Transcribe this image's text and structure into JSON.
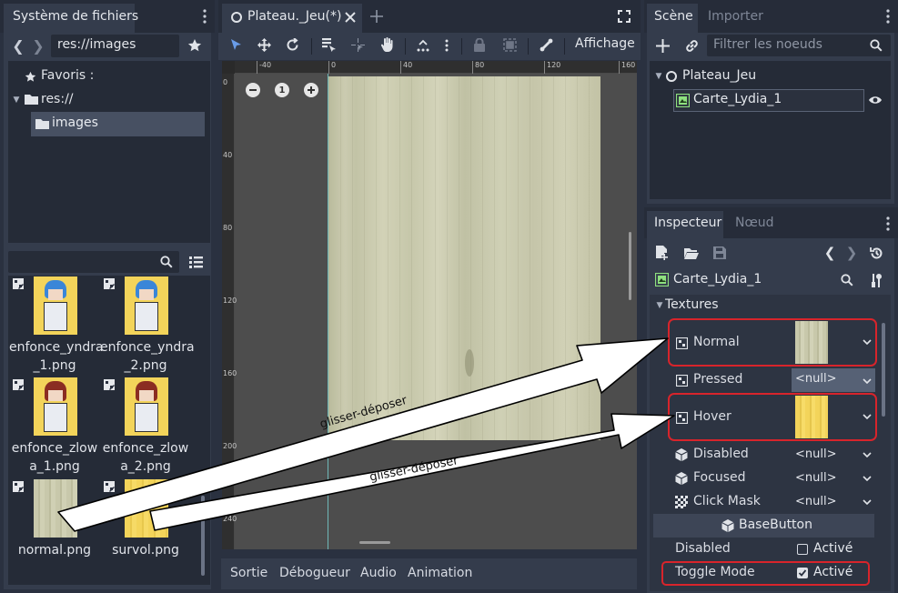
{
  "filesystem": {
    "title": "Système de fichiers",
    "path": "res://images",
    "tree": {
      "favorites": "Favoris :",
      "root": "res://",
      "folder": "images"
    },
    "files": [
      {
        "name_line1": "enfonce_yndra",
        "name_line2": "_1.png"
      },
      {
        "name_line1": "enfonce_yndra",
        "name_line2": "_2.png"
      },
      {
        "name_line1": "enfonce_zlow",
        "name_line2": "a_1.png"
      },
      {
        "name_line1": "enfonce_zlow",
        "name_line2": "a_2.png"
      },
      {
        "name_line1": "normal.png",
        "name_line2": ""
      },
      {
        "name_line1": "survol.png",
        "name_line2": ""
      }
    ]
  },
  "editor": {
    "tab_title": "Plateau._Jeu(*)",
    "view_menu": "Affichage",
    "ruler_top": [
      "-40",
      "0",
      "40",
      "80",
      "120",
      "160"
    ],
    "ruler_left": [
      "0",
      "40",
      "80",
      "120",
      "160",
      "200",
      "240"
    ],
    "zoom_reset": "1",
    "bottom_tabs": [
      "Sortie",
      "Débogueur",
      "Audio",
      "Animation"
    ]
  },
  "annotations": {
    "arrow1": "glisser-déposer",
    "arrow2": "glisser-déposer"
  },
  "scene": {
    "tab_scene": "Scène",
    "tab_import": "Importer",
    "filter_placeholder": "Filtrer les noeuds",
    "root_node": "Plateau_Jeu",
    "child_node": "Carte_Lydia_1"
  },
  "inspector": {
    "tab_inspector": "Inspecteur",
    "tab_node": "Nœud",
    "node_name": "Carte_Lydia_1",
    "section": "Textures",
    "props": [
      {
        "label": "Normal",
        "value": ""
      },
      {
        "label": "Pressed",
        "value": "<null>"
      },
      {
        "label": "Hover",
        "value": ""
      },
      {
        "label": "Disabled",
        "value": "<null>"
      },
      {
        "label": "Focused",
        "value": "<null>"
      },
      {
        "label": "Click Mask",
        "value": "<null>"
      }
    ],
    "category": "BaseButton",
    "bool_props": [
      {
        "label": "Disabled",
        "value": "Activé",
        "checked": false
      },
      {
        "label": "Toggle Mode",
        "value": "Activé",
        "checked": true
      }
    ]
  },
  "colors": {
    "accent": "#699ce8",
    "highlight_red": "#d8242b",
    "wood": "#c9c9ad",
    "yellow": "#f3d45a"
  }
}
